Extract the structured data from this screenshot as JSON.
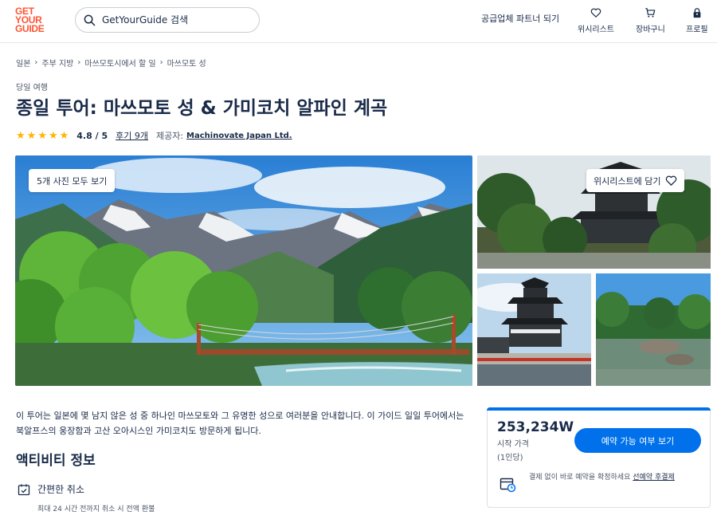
{
  "header": {
    "logo_lines": [
      "GET",
      "YOUR",
      "GUIDE"
    ],
    "search_placeholder": "GetYourGuide 검색",
    "partner_link": "공급업체 파트너 되기",
    "nav": [
      {
        "label": "위시리스트",
        "icon": "heart-icon"
      },
      {
        "label": "장바구니",
        "icon": "cart-icon"
      },
      {
        "label": "프로필",
        "icon": "profile-icon"
      }
    ]
  },
  "breadcrumb": [
    "일본",
    "주부 지방",
    "마쓰모토시에서 할 일",
    "마쓰모토 성"
  ],
  "activity": {
    "category": "당일 여행",
    "title": "종일 투어: 마쓰모토 성 & 가미코치 알파인 계곡",
    "rating": "4.8 / 5",
    "reviews": "후기 9개",
    "provider_label": "제공자:",
    "provider": "Machinovate Japan Ltd."
  },
  "gallery": {
    "see_all_photos": "5개 사진 모두 보기",
    "add_to_wishlist": "위시리스트에 담기"
  },
  "description": "이 투어는 일본에 몇 남지 않은 성 중 하나인 마쓰모토와 그 유명한 성으로 여러분을 안내합니다. 이 가이드 일일 투어에서는 북알프스의 웅장함과 고산 오아시스인 가미코치도 방문하게 됩니다.",
  "about": {
    "title": "액티비티 정보",
    "features": [
      {
        "icon": "calendar-check-icon",
        "label": "간편한 취소",
        "sub": "최대 24 시간 전까지 취소 시 전액 환불"
      }
    ]
  },
  "booking": {
    "price": "253,234W",
    "price_from": "시작 가격",
    "price_unit": "(1인당)",
    "check_button": "예약 가능 여부 보기",
    "reserve_text": "결제 없이 바로 예약을 확정하세요",
    "reserve_link": "선예약 후결제"
  },
  "colors": {
    "brand": "#ff5533",
    "primary": "#0071eb",
    "text": "#1a2b49",
    "star": "#ffb400"
  }
}
